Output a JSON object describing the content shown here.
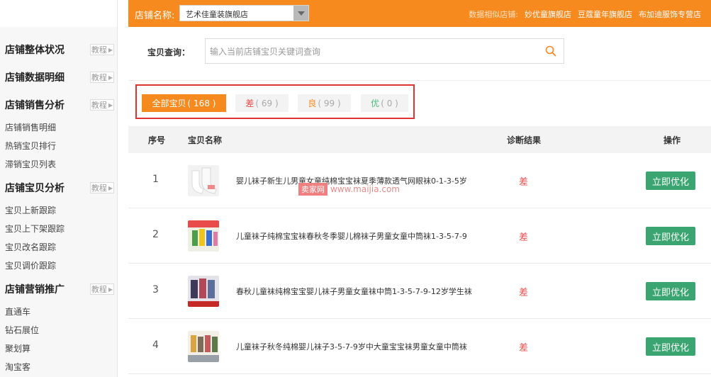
{
  "topbar": {
    "shop_label": "店铺名称:",
    "shop_value": "艺术佳童装旗舰店",
    "similar_label": "数据相似店铺:",
    "similar_shops": [
      "妙优童旗舰店",
      "豆蔻童年旗舰店",
      "布加迪服饰专营店"
    ]
  },
  "sidebar": {
    "sections": [
      {
        "title": "店铺整体状况",
        "tag": "教程",
        "items": []
      },
      {
        "title": "店铺数据明细",
        "tag": "教程",
        "items": []
      },
      {
        "title": "店铺销售分析",
        "tag": "教程",
        "items": [
          "店铺销售明细",
          "热销宝贝排行",
          "滞销宝贝列表"
        ]
      },
      {
        "title": "店铺宝贝分析",
        "tag": "教程",
        "items": [
          "宝贝上新跟踪",
          "宝贝上下架跟踪",
          "宝贝改名跟踪",
          "宝贝调价跟踪"
        ]
      },
      {
        "title": "店铺营销推广",
        "tag": "教程",
        "items": [
          "直通车",
          "钻石展位",
          "聚划算",
          "淘宝客"
        ]
      }
    ]
  },
  "search": {
    "label": "宝贝查询：",
    "placeholder": "输入当前店铺宝贝关键词查询",
    "value": ""
  },
  "filters": {
    "all": {
      "label": "全部宝贝",
      "count": "168"
    },
    "bad": {
      "label": "差",
      "count": "69"
    },
    "good": {
      "label": "良",
      "count": "99"
    },
    "excellent": {
      "label": "优",
      "count": "0"
    }
  },
  "table": {
    "headers": {
      "index": "序号",
      "name": "宝贝名称",
      "result": "诊断结果",
      "action": "操作"
    },
    "rows": [
      {
        "index": "1",
        "title": "婴儿袜子新生儿男童女童纯棉宝宝袜夏季薄款透气网眼袜0-1-3-5岁",
        "result": "差",
        "action": "立即优化"
      },
      {
        "index": "2",
        "title": "儿童袜子纯棉宝宝袜春秋冬季婴儿棉袜子男童女童中筒袜1-3-5-7-9",
        "result": "差",
        "action": "立即优化"
      },
      {
        "index": "3",
        "title": "春秋儿童袜纯棉宝宝婴儿袜子男童女童袜中筒1-3-5-7-9-12岁学生袜",
        "result": "差",
        "action": "立即优化"
      },
      {
        "index": "4",
        "title": "儿童袜子秋冬纯棉婴儿袜子3-5-7-9岁中大童宝宝袜男童女童中筒袜",
        "result": "差",
        "action": "立即优化"
      }
    ]
  },
  "watermark": {
    "badge": "卖家网",
    "url": "www.maijia.com"
  },
  "colors": {
    "accent": "#f68a1f",
    "bad": "#e94b4b",
    "good": "#f68a1f",
    "excellent": "#4dbb7a",
    "action": "#3aa570"
  }
}
